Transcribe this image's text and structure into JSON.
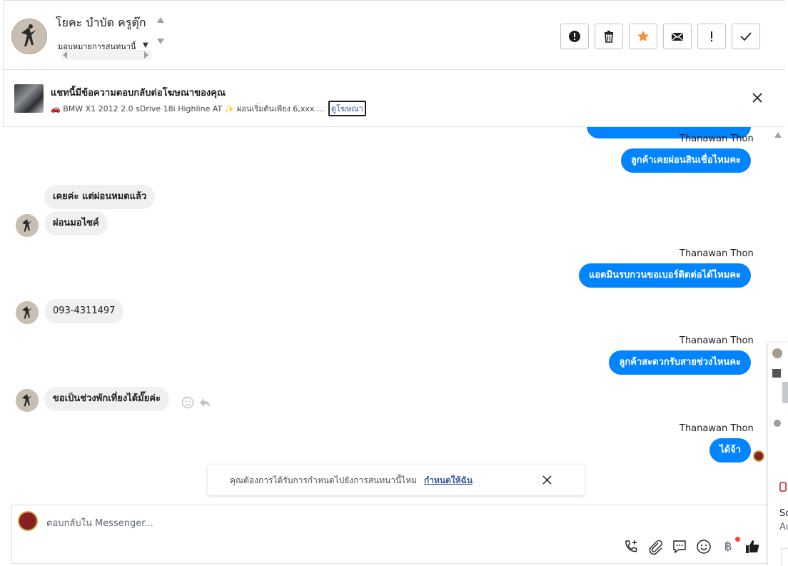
{
  "header": {
    "contact_name": "โยคะ บำบัด ครูตุ๊ก",
    "assign_label": "มอบหมายการสนทนานี้",
    "toolbar": [
      "report-icon",
      "delete-icon",
      "star-icon",
      "mark-unread-icon",
      "important-icon",
      "done-icon"
    ]
  },
  "ad": {
    "title": "แชทนี้มีข้อความตอบกลับต่อโฆษณาของคุณ",
    "subtitle": "🚗 BMW X1 2012 2.0 sDrive 18i Highline AT ✨ ผ่อนเริ่มต้นเพียง 6,xxx....",
    "link": "ดูโฆษณา"
  },
  "messages": {
    "m1_sender": "Thanawan Thon",
    "m1_text": "ลูกค้าเคยผ่อนสินเชื่อไหมคะ",
    "m2_text": "เคยค่ะ แต่ผ่อนหมดแล้ว",
    "m3_text": "ผ่อนมอไซค์",
    "m4_sender": "Thanawan Thon",
    "m4_text": "แอดมินรบกวนขอเบอร์ติดต่อได้ไหมคะ",
    "m5_text": "093-4311497",
    "m6_sender": "Thanawan Thon",
    "m6_text": "ลูกค้าสะดวกรับสายช่วงไหนคะ",
    "m7_text": "ขอเป็นช่วงพักเที่ยงได้มั๊ยค่ะ",
    "m8_sender": "Thanawan Thon",
    "m8_text": "ได้จ้า"
  },
  "reminder": {
    "text": "คุณต้องการได้รับการกำหนดไปยังการสนทนานี้ไหม",
    "link": "กำหนดให้ฉัน"
  },
  "composer": {
    "placeholder": "ตอบกลับใน Messenger...",
    "currency_symbol": "฿"
  },
  "right_panel": {
    "t1": "Sc",
    "t2": "Au"
  },
  "colors": {
    "accent": "#0084ff",
    "incoming": "#f1f0f0",
    "star": "#f7923b"
  }
}
